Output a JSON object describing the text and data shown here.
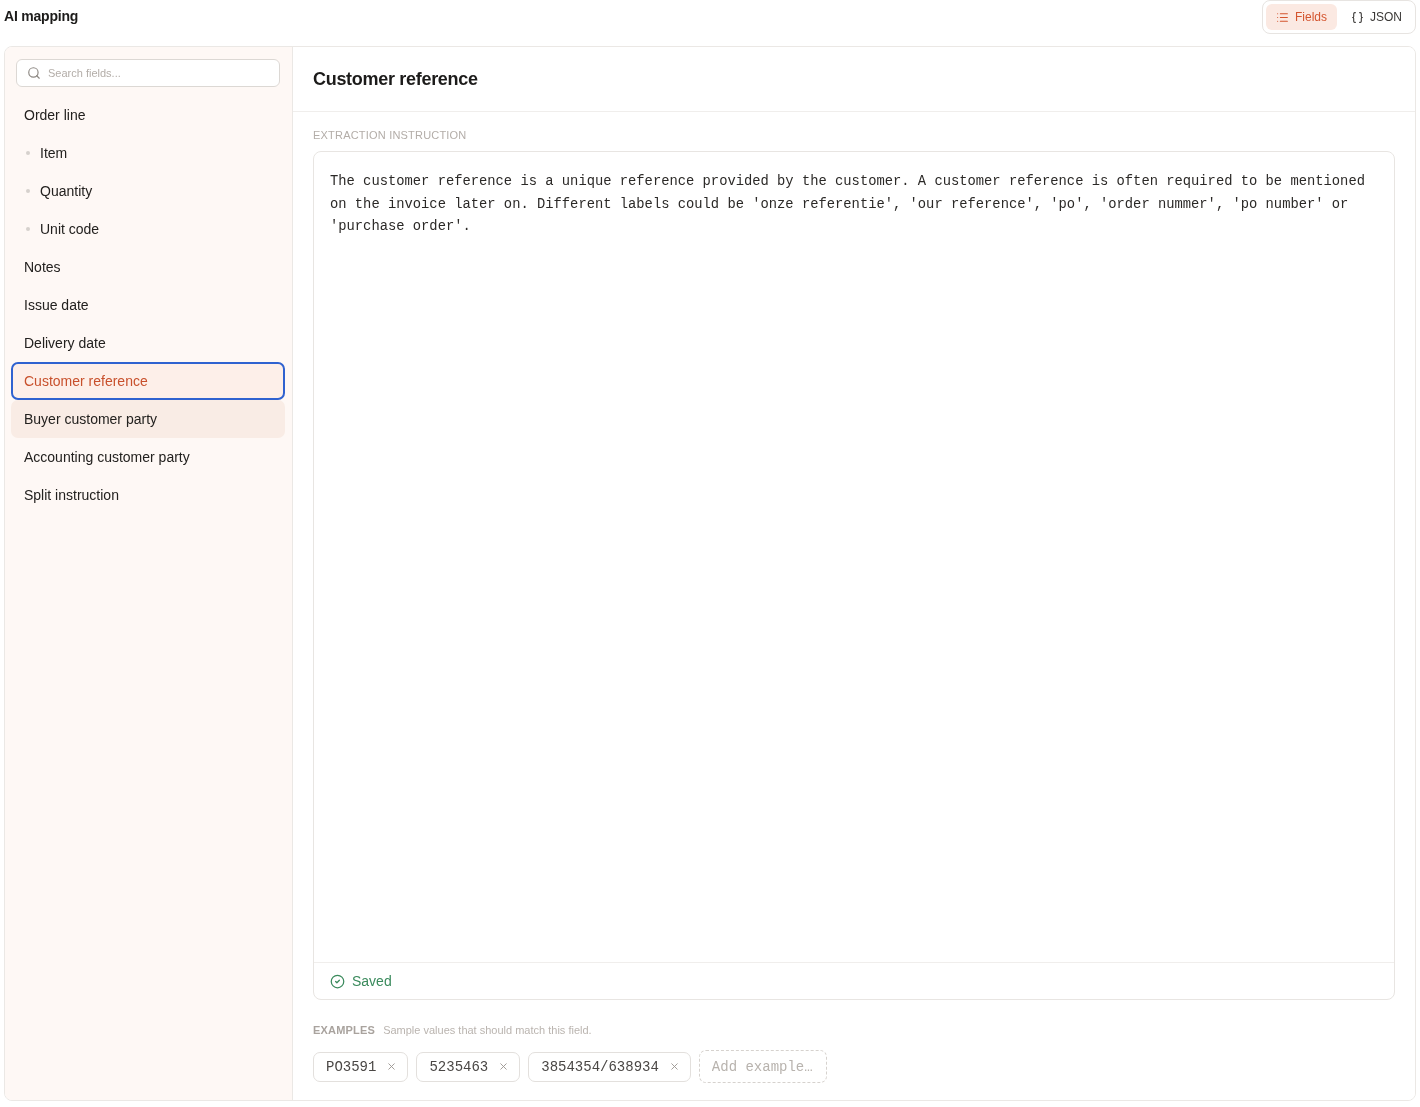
{
  "header": {
    "title": "AI mapping",
    "view_toggle": [
      {
        "label": "Fields",
        "selected": true
      },
      {
        "label": "JSON",
        "selected": false
      }
    ]
  },
  "sidebar": {
    "search": {
      "placeholder": "Search fields..."
    },
    "items": [
      {
        "label": "Order line",
        "selected": false,
        "hovered": false,
        "children": [
          {
            "label": "Item",
            "selected": false,
            "hovered": false
          },
          {
            "label": "Quantity",
            "selected": false,
            "hovered": false
          },
          {
            "label": "Unit code",
            "selected": false,
            "hovered": false
          }
        ]
      },
      {
        "label": "Notes",
        "selected": false,
        "hovered": false
      },
      {
        "label": "Issue date",
        "selected": false,
        "hovered": false
      },
      {
        "label": "Delivery date",
        "selected": false,
        "hovered": false
      },
      {
        "label": "Customer reference",
        "selected": true,
        "hovered": false
      },
      {
        "label": "Buyer customer party",
        "selected": false,
        "hovered": true
      },
      {
        "label": "Accounting customer party",
        "selected": false,
        "hovered": false
      },
      {
        "label": "Split instruction",
        "selected": false,
        "hovered": false
      }
    ]
  },
  "detail": {
    "title": "Customer reference",
    "instruction": {
      "label": "EXTRACTION INSTRUCTION",
      "value": "The customer reference is a unique reference provided by the customer. A customer reference is often required to be mentioned on the invoice later on. Different labels could be 'onze referentie', 'our reference', 'po', 'order nummer', 'po number' or 'purchase order'.",
      "status": {
        "kind": "saved",
        "label": "Saved"
      }
    },
    "examples": {
      "label": "EXAMPLES",
      "hint": "Sample values that should match this field.",
      "values": [
        "PO3591",
        "5235463",
        "3854354/638934"
      ],
      "add": {
        "placeholder": "Add example…"
      }
    }
  }
}
